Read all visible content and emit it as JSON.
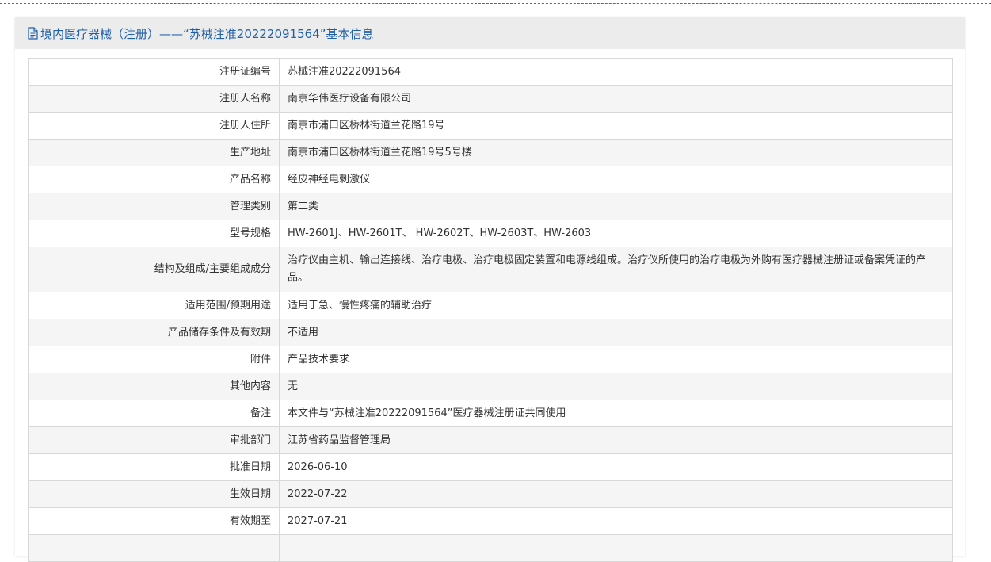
{
  "header": {
    "title": "境内医疗器械（注册）——“苏械注准20222091564”基本信息",
    "icon": "document-icon"
  },
  "colors": {
    "accent": "#1f5fa8",
    "header_bg": "#ececec",
    "row_alt_bg": "#f5f5f5",
    "border": "#d8d8d8"
  },
  "rows": [
    {
      "label": "注册证编号",
      "value": "苏械注准20222091564"
    },
    {
      "label": "注册人名称",
      "value": "南京华伟医疗设备有限公司"
    },
    {
      "label": "注册人住所",
      "value": "南京市浦口区桥林街道兰花路19号"
    },
    {
      "label": "生产地址",
      "value": "南京市浦口区桥林街道兰花路19号5号楼"
    },
    {
      "label": "产品名称",
      "value": "经皮神经电刺激仪"
    },
    {
      "label": "管理类别",
      "value": "第二类"
    },
    {
      "label": "型号规格",
      "value": "HW-2601J、HW-2601T、 HW-2602T、HW-2603T、HW-2603"
    },
    {
      "label": "结构及组成/主要组成成分",
      "value": "治疗仪由主机、输出连接线、治疗电极、治疗电极固定装置和电源线组成。治疗仪所使用的治疗电极为外购有医疗器械注册证或备案凭证的产品。"
    },
    {
      "label": "适用范围/预期用途",
      "value": "适用于急、慢性疼痛的辅助治疗"
    },
    {
      "label": "产品储存条件及有效期",
      "value": "不适用"
    },
    {
      "label": "附件",
      "value": "产品技术要求"
    },
    {
      "label": "其他内容",
      "value": "无"
    },
    {
      "label": "备注",
      "value": "本文件与“苏械注准20222091564”医疗器械注册证共同使用"
    },
    {
      "label": "审批部门",
      "value": "江苏省药品监督管理局"
    },
    {
      "label": "批准日期",
      "value": "2026-06-10"
    },
    {
      "label": "生效日期",
      "value": "2022-07-22"
    },
    {
      "label": "有效期至",
      "value": "2027-07-21"
    },
    {
      "label": "",
      "value": ""
    }
  ]
}
